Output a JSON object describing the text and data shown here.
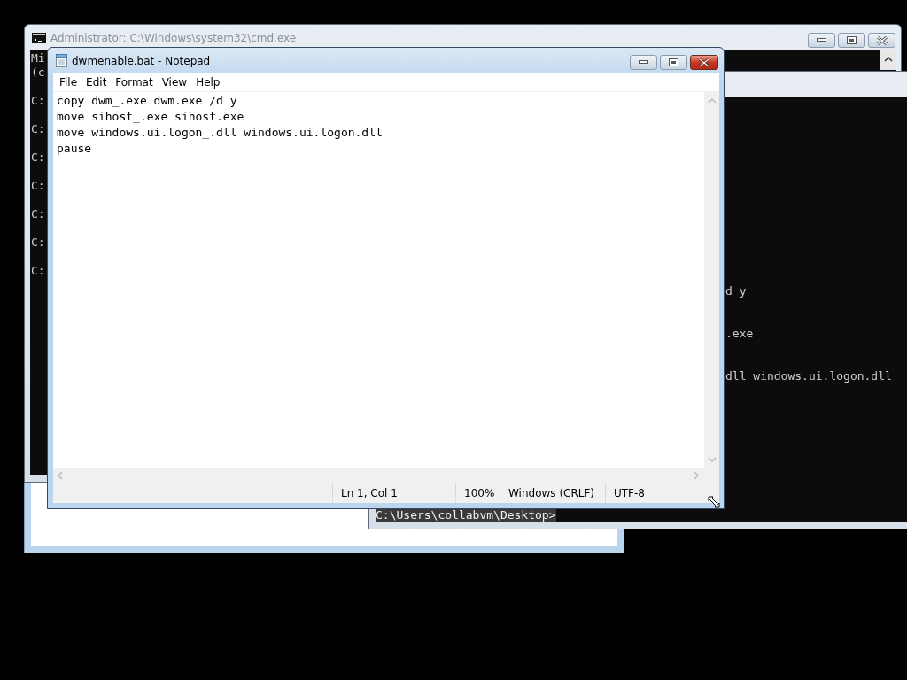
{
  "admin_console": {
    "title": "Administrator: C:\\Windows\\system32\\cmd.exe",
    "header_lines": [
      "Mi",
      "(c"
    ],
    "prompt_lines": [
      "C:",
      "C:",
      "C:",
      "C:",
      "C:",
      "C:",
      "C:"
    ]
  },
  "second_console": {
    "output_lines": [
      "d y",
      ".exe",
      "dll windows.ui.logon.dll"
    ],
    "prompt": "C:\\Users\\collabvm\\Desktop>"
  },
  "notepad": {
    "title": "dwmenable.bat - Notepad",
    "menu": [
      "File",
      "Edit",
      "Format",
      "View",
      "Help"
    ],
    "lines": [
      "copy dwm_.exe dwm.exe /d y",
      "move sihost_.exe sihost.exe",
      "move windows.ui.logon_.dll windows.ui.logon.dll",
      "pause"
    ],
    "status": [
      "Ln 1, Col 1",
      "100%",
      "Windows (CRLF)",
      "UTF-8"
    ]
  }
}
